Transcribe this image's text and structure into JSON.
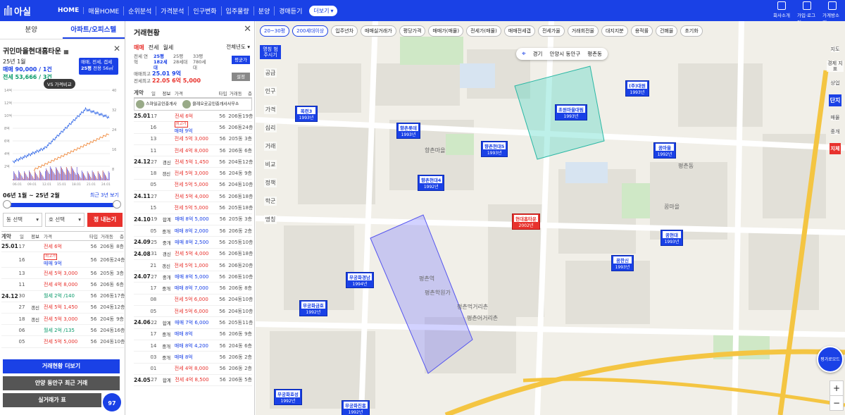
{
  "brand": {
    "name": "아실"
  },
  "nav": {
    "items": [
      "HOME",
      "매물HOME",
      "순위분석",
      "가격분석",
      "인구변화",
      "입주물량",
      "분양",
      "경매듣기"
    ],
    "more": "더보기"
  },
  "rtools": [
    "회사소개",
    "가입·로그인",
    "가게방소개"
  ],
  "left": {
    "tabs": [
      "분양",
      "아파트/오피스텔"
    ],
    "apt_name": "귀인마을현대홈타운",
    "month": "25년 1월",
    "sale_line": "매매 90,000 / 1건",
    "jeonse_line": "전세 53,666 / 3건",
    "box_line1": "매매, 전세, 갭세",
    "box_line2": "25평",
    "box_line3": "전용 56㎡",
    "vs": "VS 가격비교",
    "chart_y_left": [
      "14억",
      "12억",
      "10억",
      "8억",
      "6억",
      "4억",
      "2억"
    ],
    "chart_y_right": [
      "40",
      "32",
      "24",
      "16",
      "8"
    ],
    "chart_x": [
      "06.01",
      "09.01",
      "12.01",
      "15.01",
      "18.01",
      "21.01",
      "24.01"
    ],
    "period": "06년 1월 ~ 25년 2월",
    "period_link": "최근 3년 보기",
    "sel1": "동 선택",
    "sel2": "호 선택",
    "search": "정 내는기",
    "headers": [
      "계약",
      "일",
      "정보",
      "가격",
      "타입",
      "거래동",
      "층"
    ],
    "rows": [
      {
        "ym": "25.01",
        "d": "17",
        "info": "",
        "tag": "",
        "price": "전세 6억",
        "type": "56",
        "dong": "206동",
        "fl": "8층"
      },
      {
        "ym": "",
        "d": "16",
        "info": "",
        "tag": "최고가",
        "price": "매매 9억",
        "type": "56",
        "dong": "206동",
        "fl": "24층"
      },
      {
        "ym": "",
        "d": "13",
        "info": "",
        "tag": "",
        "price": "전세 5억 3,000",
        "type": "56",
        "dong": "205동",
        "fl": "3층"
      },
      {
        "ym": "",
        "d": "11",
        "info": "",
        "tag": "",
        "price": "전세 4억 8,000",
        "type": "56",
        "dong": "206동",
        "fl": "6층"
      },
      {
        "ym": "24.12",
        "d": "30",
        "info": "",
        "tag": "",
        "price": "월세 2억 /140",
        "type": "56",
        "dong": "206동",
        "fl": "17층"
      },
      {
        "ym": "",
        "d": "27",
        "info": "갱신",
        "tag": "",
        "price": "전세 5억 1,450",
        "type": "56",
        "dong": "204동",
        "fl": "12층"
      },
      {
        "ym": "",
        "d": "18",
        "info": "갱신",
        "tag": "",
        "price": "전세 5억 3,000",
        "type": "56",
        "dong": "204동",
        "fl": "9층"
      },
      {
        "ym": "",
        "d": "06",
        "info": "",
        "tag": "",
        "price": "월세 2억 /135",
        "type": "56",
        "dong": "204동",
        "fl": "16층"
      },
      {
        "ym": "",
        "d": "05",
        "info": "",
        "tag": "",
        "price": "전세 5억 5,000",
        "type": "56",
        "dong": "204동",
        "fl": "10층"
      }
    ],
    "btn_more": "거래현황 더보기",
    "btn_recent": "안양 동안구 최근 거래",
    "btn_table": "실거래가 표",
    "badge": "97"
  },
  "middle": {
    "title": "거래현황",
    "tabs": [
      "매매",
      "전세",
      "월세"
    ],
    "year": "전체년도",
    "types": [
      "전세 연혁",
      "25평 182세대",
      "25평 28세대",
      "33평 780세대"
    ],
    "btn_a": "평균가",
    "btn_b": "설정",
    "high_label1": "매매최고",
    "high_val1": "25.01 9억",
    "high_label2": "전세최고",
    "high_val2": "22.05 6억 5,000",
    "agent1": "스마일공인중개사",
    "agent2": "클레오로공인중개사사무소",
    "headers": [
      "계약",
      "일",
      "정보",
      "가격",
      "타입",
      "거래동",
      "층"
    ],
    "rows": [
      {
        "ym": "25.01",
        "d": "17",
        "info": "",
        "tag": "",
        "price": "전세 6억",
        "type": "56",
        "dong": "206동",
        "fl": "19층"
      },
      {
        "ym": "",
        "d": "16",
        "info": "",
        "tag": "최고가",
        "price": "매매 9억",
        "type": "56",
        "dong": "206동",
        "fl": "24층"
      },
      {
        "ym": "",
        "d": "13",
        "info": "",
        "tag": "",
        "price": "전세 5억 3,000",
        "type": "56",
        "dong": "205동",
        "fl": "3층"
      },
      {
        "ym": "",
        "d": "11",
        "info": "",
        "tag": "",
        "price": "전세 4억 8,000",
        "type": "56",
        "dong": "206동",
        "fl": "6층"
      },
      {
        "ym": "24.12",
        "d": "27",
        "info": "갱신",
        "tag": "",
        "price": "전세 5억 1,450",
        "type": "56",
        "dong": "204동",
        "fl": "12층"
      },
      {
        "ym": "",
        "d": "18",
        "info": "갱신",
        "tag": "",
        "price": "전세 5억 3,000",
        "type": "56",
        "dong": "204동",
        "fl": "9층"
      },
      {
        "ym": "",
        "d": "05",
        "info": "",
        "tag": "",
        "price": "전세 5억 5,000",
        "type": "56",
        "dong": "204동",
        "fl": "10층"
      },
      {
        "ym": "24.11",
        "d": "27",
        "info": "",
        "tag": "",
        "price": "전세 5억 4,000",
        "type": "56",
        "dong": "206동",
        "fl": "18층"
      },
      {
        "ym": "",
        "d": "15",
        "info": "",
        "tag": "",
        "price": "전세 5억 5,000",
        "type": "56",
        "dong": "205동",
        "fl": "18층"
      },
      {
        "ym": "24.10",
        "d": "19",
        "info": "합계",
        "tag": "",
        "price": "매매 8억 5,000",
        "type": "56",
        "dong": "205동",
        "fl": "3층"
      },
      {
        "ym": "",
        "d": "05",
        "info": "중개",
        "tag": "",
        "price": "매매 8억 2,000",
        "type": "56",
        "dong": "206동",
        "fl": "2층"
      },
      {
        "ym": "24.09",
        "d": "25",
        "info": "중개",
        "tag": "",
        "price": "매매 8억 2,500",
        "type": "56",
        "dong": "205동",
        "fl": "10층"
      },
      {
        "ym": "24.08",
        "d": "31",
        "info": "갱신",
        "tag": "",
        "price": "전세 5억 4,000",
        "type": "56",
        "dong": "206동",
        "fl": "18층"
      },
      {
        "ym": "",
        "d": "21",
        "info": "갱신",
        "tag": "",
        "price": "전세 5억 1,000",
        "type": "56",
        "dong": "206동",
        "fl": "20층"
      },
      {
        "ym": "24.07",
        "d": "27",
        "info": "중개",
        "tag": "",
        "price": "매매 8억 5,000",
        "type": "56",
        "dong": "206동",
        "fl": "10층"
      },
      {
        "ym": "",
        "d": "17",
        "info": "중개",
        "tag": "",
        "price": "매매 8억 7,000",
        "type": "56",
        "dong": "206동",
        "fl": "8층"
      },
      {
        "ym": "",
        "d": "08",
        "info": "",
        "tag": "",
        "price": "전세 5억 6,000",
        "type": "56",
        "dong": "204동",
        "fl": "10층"
      },
      {
        "ym": "",
        "d": "05",
        "info": "",
        "tag": "",
        "price": "전세 5억 6,000",
        "type": "56",
        "dong": "204동",
        "fl": "10층"
      },
      {
        "ym": "24.06",
        "d": "22",
        "info": "합계",
        "tag": "",
        "price": "매매 7억 6,000",
        "type": "56",
        "dong": "205동",
        "fl": "11층"
      },
      {
        "ym": "",
        "d": "17",
        "info": "중개",
        "tag": "",
        "price": "매매 8억",
        "type": "56",
        "dong": "206동",
        "fl": "9층"
      },
      {
        "ym": "",
        "d": "14",
        "info": "중개",
        "tag": "",
        "price": "매매 8억 4,200",
        "type": "56",
        "dong": "204동",
        "fl": "6층"
      },
      {
        "ym": "",
        "d": "03",
        "info": "중개",
        "tag": "",
        "price": "매매 8억",
        "type": "56",
        "dong": "206동",
        "fl": "2층"
      },
      {
        "ym": "",
        "d": "01",
        "info": "",
        "tag": "",
        "price": "전세 4억 8,000",
        "type": "56",
        "dong": "206동",
        "fl": "2층"
      },
      {
        "ym": "24.05",
        "d": "27",
        "info": "합계",
        "tag": "",
        "price": "전세 4억 8,500",
        "type": "56",
        "dong": "206동",
        "fl": "5층"
      }
    ]
  },
  "map": {
    "filters": [
      "20~30평",
      "200세대이상",
      "입주년차",
      "매매실거래가",
      "평당가격",
      "매매가(매물)",
      "전세가(매물)",
      "매매전세갭",
      "전세가율",
      "거래회전율",
      "대지지분",
      "용적률",
      "건폐율",
      "초기화"
    ],
    "left_tools": [
      "공급",
      "인구",
      "가격",
      "심리",
      "거래",
      "비교",
      "정책",
      "학군"
    ],
    "left_top": "명칭 범주시기",
    "left_bottom": "명칭",
    "right_tools": [
      "지도",
      "경제 지표",
      "상업"
    ],
    "right_blue": "단지",
    "right_mid": [
      "매물",
      "중개"
    ],
    "right_red": "지체",
    "loc": [
      "경기",
      "안양시 동안구",
      "평촌동"
    ],
    "circle": "평가로모드",
    "markers": [
      {
        "name": "목련3",
        "year": "1993년"
      },
      {
        "name": "향촌롯데",
        "year": "1993년"
      },
      {
        "name": "향촌현대5",
        "year": "1993년"
      },
      {
        "name": "향촌현대4",
        "year": "1992년"
      },
      {
        "name": "초원마을대림",
        "year": "1993년"
      },
      {
        "name": "(주)대원",
        "year": "1993년"
      },
      {
        "name": "꿈마을",
        "year": "1992년"
      },
      {
        "name": "현대홈타운",
        "year": "2002년"
      },
      {
        "name": "꿈현대",
        "year": "1993년"
      },
      {
        "name": "꿈한신",
        "year": "1993년"
      },
      {
        "name": "무궁화경남",
        "year": "1994년"
      },
      {
        "name": "무궁화금호",
        "year": "1992년"
      },
      {
        "name": "무궁화효성",
        "year": "1992년"
      },
      {
        "name": "무궁화진흥",
        "year": "1992년"
      }
    ],
    "place_labels": [
      "향촌마을",
      "평촌동",
      "꿈마을",
      "평촌역",
      "평촌학원가",
      "평촌먹거리촌",
      "평촌어거리촌"
    ]
  }
}
